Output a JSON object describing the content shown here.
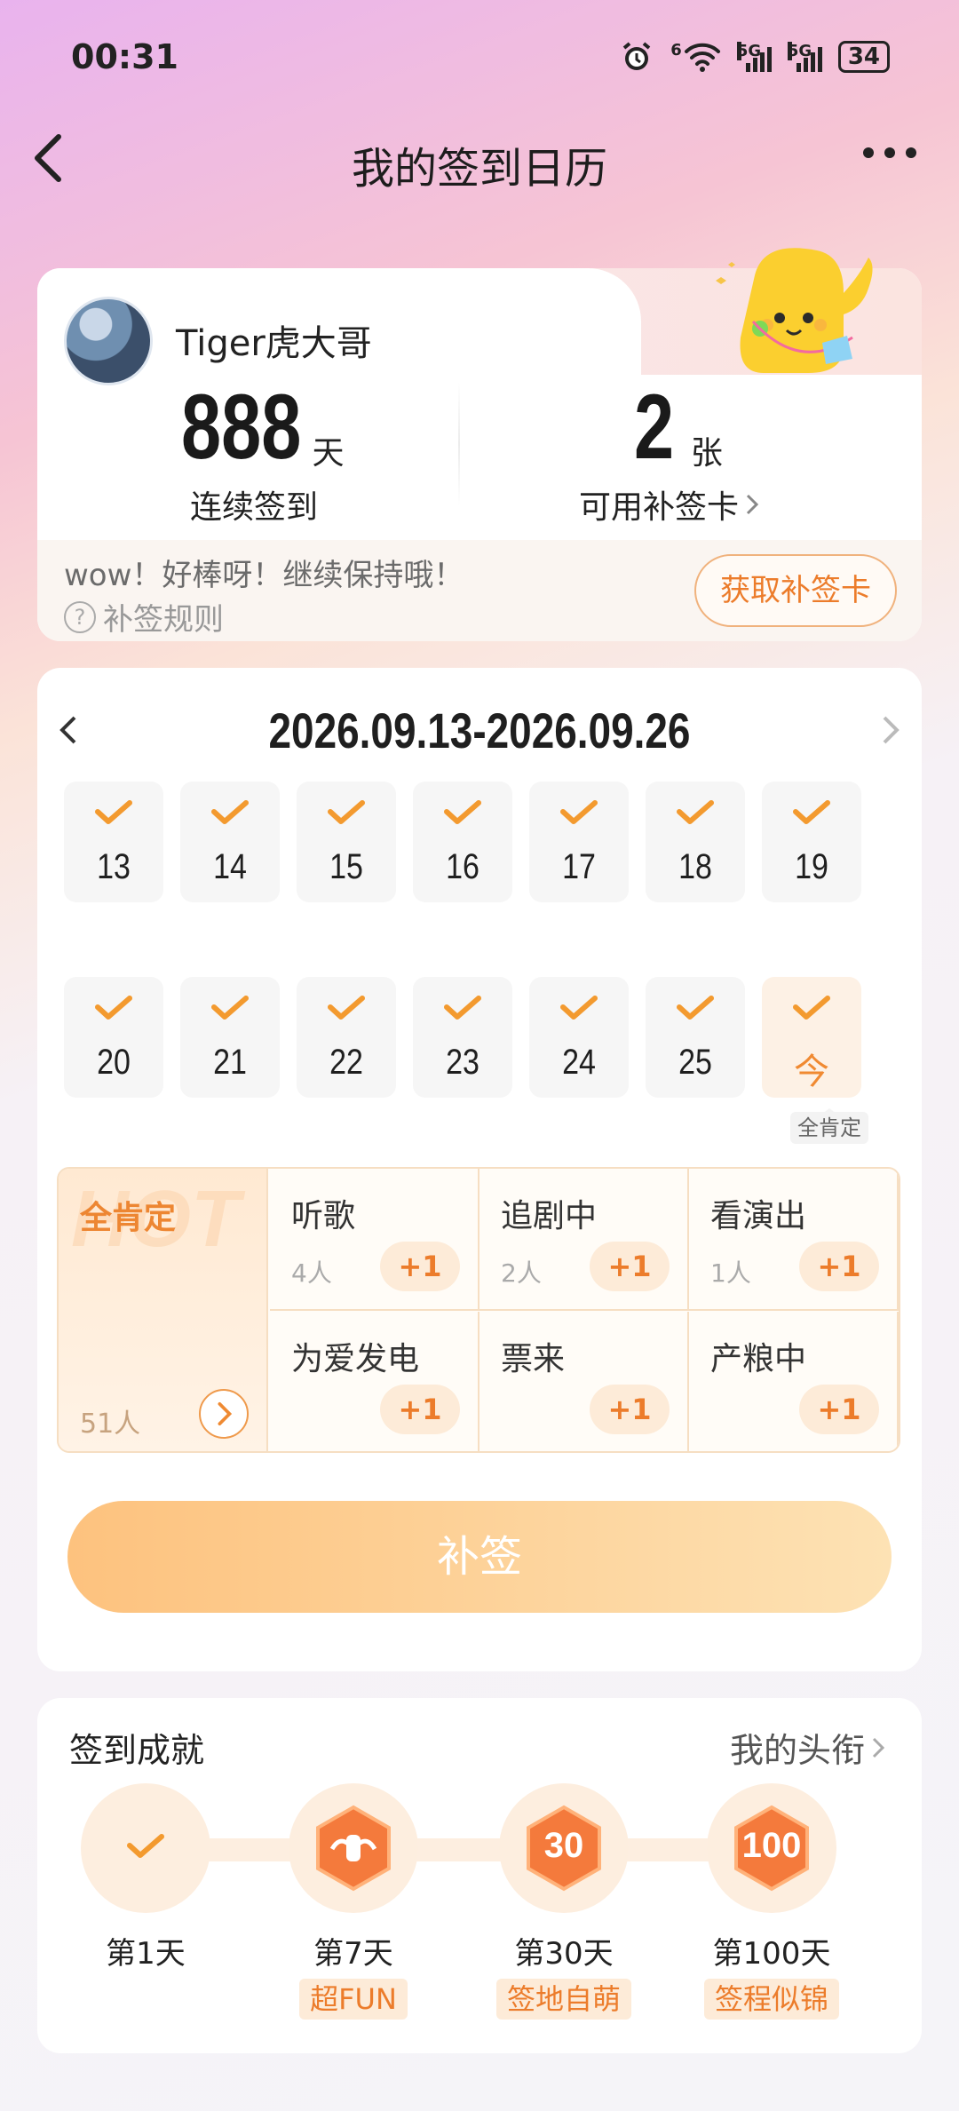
{
  "status_bar": {
    "time": "00:31",
    "battery": "34",
    "net1": "5G",
    "net2": "5G",
    "wifi_badge": "6"
  },
  "nav": {
    "title": "我的签到日历"
  },
  "profile": {
    "username": "Tiger虎大哥",
    "streak_value": "888",
    "streak_unit": "天",
    "streak_label": "连续签到",
    "cards_value": "2",
    "cards_unit": "张",
    "cards_label": "可用补签卡",
    "notice": "wow！好棒呀！继续保持哦！",
    "rule_link": "补签规则",
    "get_card_button": "获取补签卡"
  },
  "calendar": {
    "range": "2026.09.13-2026.09.26",
    "week1": [
      "13",
      "14",
      "15",
      "16",
      "17",
      "18",
      "19"
    ],
    "week2": [
      "20",
      "21",
      "22",
      "23",
      "24",
      "25"
    ],
    "today_label": "今",
    "today_mood": "全肯定",
    "all_signed": true
  },
  "moods": {
    "hot": {
      "name": "全肯定",
      "watermark": "HOT",
      "count": "51人"
    },
    "items": [
      {
        "name": "听歌",
        "count": "4人",
        "plus": "+1"
      },
      {
        "name": "追剧中",
        "count": "2人",
        "plus": "+1"
      },
      {
        "name": "看演出",
        "count": "1人",
        "plus": "+1"
      },
      {
        "name": "为爱发电",
        "count": "",
        "plus": "+1"
      },
      {
        "name": "票来",
        "count": "",
        "plus": "+1"
      },
      {
        "name": "产粮中",
        "count": "",
        "plus": "+1"
      }
    ]
  },
  "supplement_button": "补签",
  "achievements": {
    "title": "签到成就",
    "link": "我的头衔",
    "items": [
      {
        "day": "第1天",
        "tag": ""
      },
      {
        "day": "第7天",
        "tag": "超FUN"
      },
      {
        "day": "第30天",
        "tag": "签地自萌",
        "badge_text": "30"
      },
      {
        "day": "第100天",
        "tag": "签程似锦",
        "badge_text": "100"
      }
    ]
  },
  "colors": {
    "accent": "#ec7c2b",
    "check": "#f39a2f",
    "button_start": "#fdc27e",
    "button_end": "#fde2b4"
  }
}
